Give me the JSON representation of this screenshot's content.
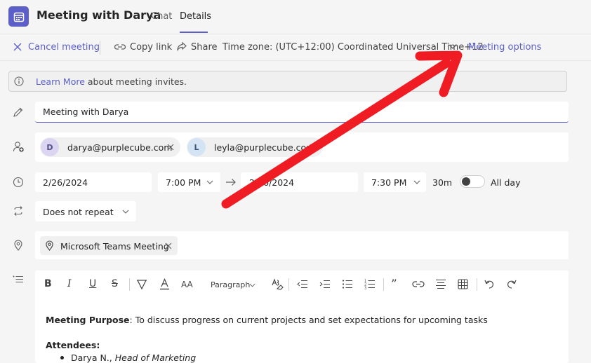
{
  "header": {
    "title": "Meeting with Darya",
    "tabs": [
      {
        "label": "Chat",
        "active": false
      },
      {
        "label": "Details",
        "active": true
      }
    ]
  },
  "toolbar": {
    "cancel_label": "Cancel meeting",
    "copy_link_label": "Copy link",
    "share_label": "Share",
    "timezone_label": "Time zone: (UTC+12:00) Coordinated Universal Time+12",
    "meeting_options_label": "Meeting options"
  },
  "info_banner": {
    "link_text": "Learn More",
    "text": "about meeting invites."
  },
  "form": {
    "title_value": "Meeting with Darya",
    "attendees": [
      {
        "initial": "D",
        "email": "darya@purplecube.com"
      },
      {
        "initial": "L",
        "email": "leyla@purplecube.com"
      }
    ],
    "start_date": "2/26/2024",
    "start_time": "7:00 PM",
    "end_date": "2/26/2024",
    "end_time": "7:30 PM",
    "duration": "30m",
    "all_day_label": "All day",
    "all_day_on": false,
    "repeat_value": "Does not repeat",
    "location_value": "Microsoft Teams Meeting"
  },
  "editor": {
    "paragraph_label": "Paragraph",
    "purpose_label": "Meeting Purpose",
    "purpose_text": ": To discuss progress on current projects and set expectations for upcoming tasks",
    "attendees_heading": "Attendees:",
    "attendee_1_name": "Darya N., ",
    "attendee_1_role": "Head of Marketing"
  },
  "colors": {
    "accent": "#5b5fc7",
    "annotation_arrow": "#ef1c24"
  },
  "icons": [
    "calendar-icon",
    "close-icon",
    "link-icon",
    "share-icon",
    "chevron-down-icon",
    "info-icon",
    "pencil-icon",
    "add-person-icon",
    "clock-icon",
    "repeat-icon",
    "location-icon",
    "list-icon",
    "arrow-right-icon",
    "undo-icon",
    "redo-icon"
  ]
}
